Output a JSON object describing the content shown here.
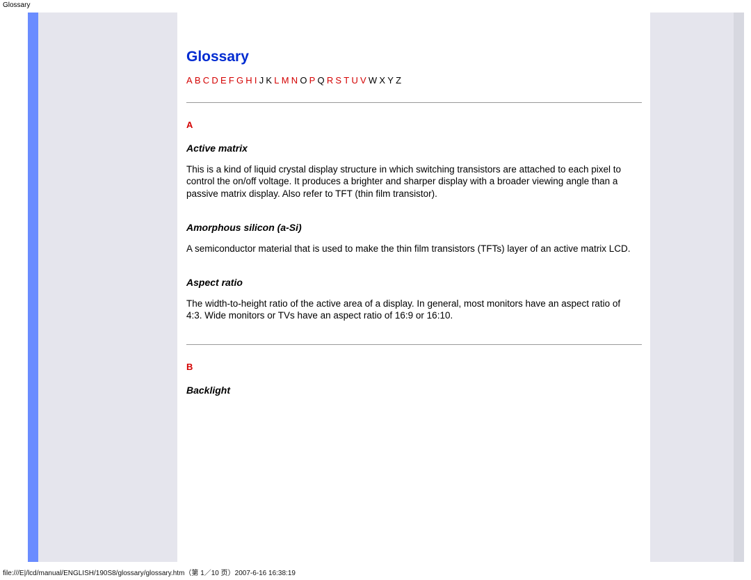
{
  "page_label": "Glossary",
  "title": "Glossary",
  "alpha": [
    {
      "t": "A",
      "link": true
    },
    {
      "t": "B",
      "link": true
    },
    {
      "t": "C",
      "link": true
    },
    {
      "t": "D",
      "link": true
    },
    {
      "t": "E",
      "link": true
    },
    {
      "t": "F",
      "link": true
    },
    {
      "t": "G",
      "link": true
    },
    {
      "t": "H",
      "link": true
    },
    {
      "t": "I",
      "link": true
    },
    {
      "t": "J",
      "link": false
    },
    {
      "t": "K",
      "link": false
    },
    {
      "t": "L",
      "link": true
    },
    {
      "t": "M",
      "link": true
    },
    {
      "t": "N",
      "link": true
    },
    {
      "t": "O",
      "link": false
    },
    {
      "t": "P",
      "link": true
    },
    {
      "t": "Q",
      "link": false
    },
    {
      "t": "R",
      "link": true
    },
    {
      "t": "S",
      "link": true
    },
    {
      "t": "T",
      "link": true
    },
    {
      "t": "U",
      "link": true
    },
    {
      "t": "V",
      "link": true
    },
    {
      "t": "W",
      "link": false
    },
    {
      "t": "X",
      "link": false
    },
    {
      "t": "Y",
      "link": false
    },
    {
      "t": "Z",
      "link": false
    }
  ],
  "sections": {
    "A": {
      "letter": "A",
      "entries": [
        {
          "term": "Active matrix",
          "desc": "This is a kind of liquid crystal display structure in which switching transistors are attached to each pixel to control the on/off voltage. It produces a brighter and sharper display with a broader viewing angle than a passive matrix display. Also refer to TFT (thin film transistor)."
        },
        {
          "term": "Amorphous silicon (a-Si)",
          "desc": "A semiconductor material that is used to make the thin film transistors (TFTs) layer of an active matrix LCD."
        },
        {
          "term": "Aspect ratio",
          "desc": "The width-to-height ratio of the active area of a display. In general, most monitors have an aspect ratio of 4:3. Wide monitors or TVs have an aspect ratio of 16:9 or 16:10."
        }
      ]
    },
    "B": {
      "letter": "B",
      "entries": [
        {
          "term": "Backlight",
          "desc": ""
        }
      ]
    }
  },
  "footer": "file:///E|/lcd/manual/ENGLISH/190S8/glossary/glossary.htm（第 1／10 页）2007-6-16 16:38:19"
}
